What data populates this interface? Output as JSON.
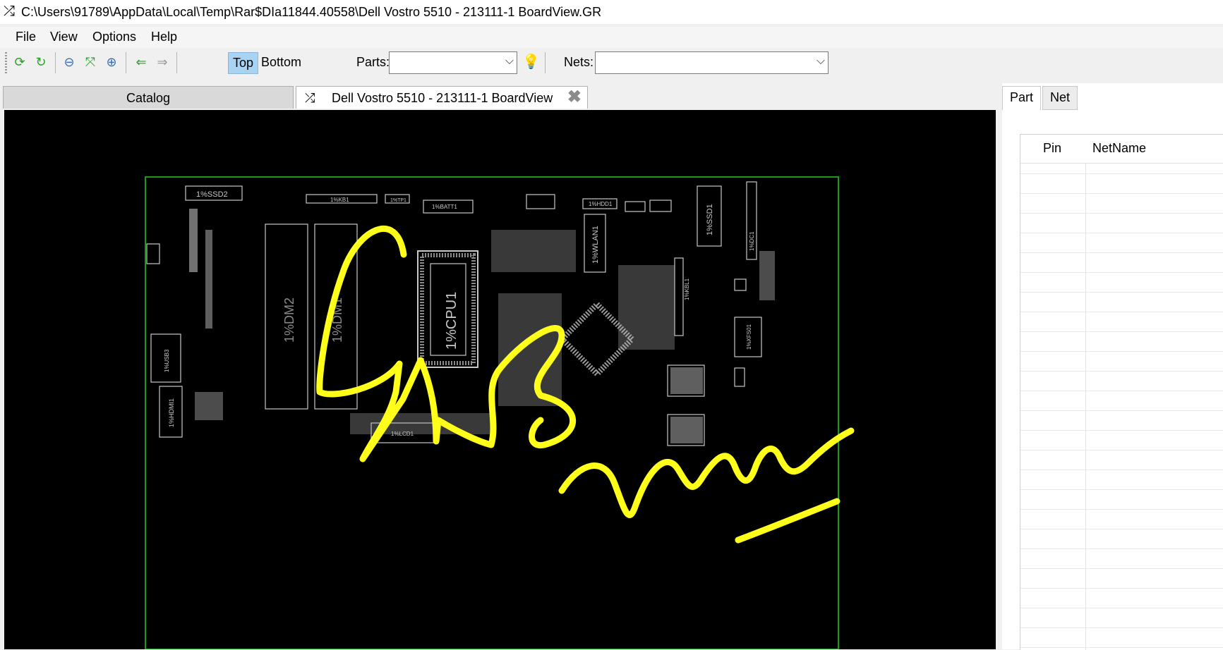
{
  "window": {
    "title": "C:\\Users\\91789\\AppData\\Local\\Temp\\Rar$DIa11844.40558\\Dell Vostro 5510 - 213111-1 BoardView.GR",
    "icon": "shuffle-icon"
  },
  "menu": [
    "File",
    "View",
    "Options",
    "Help"
  ],
  "toolbar": {
    "buttons": [
      "refresh-icon",
      "rotate-icon",
      "zoom-out-icon",
      "fit-icon",
      "zoom-in-icon",
      "back-arrow-icon",
      "forward-arrow-icon"
    ],
    "top_label": "Top",
    "bottom_label": "Bottom",
    "parts_label": "Parts:",
    "parts_value": "",
    "nets_label": "Nets:",
    "nets_value": ""
  },
  "tabs": {
    "catalog": "Catalog",
    "board": "Dell Vostro 5510 - 213111-1 BoardView"
  },
  "board": {
    "labels": [
      "1%SSD2",
      "1%KB1",
      "1%TP1",
      "1%BATT1",
      "1%HDD1",
      "1%SSD1",
      "1%WLAN1",
      "1%CPU1",
      "1%DM2",
      "1%DM1",
      "1%USB3",
      "1%HDMI1",
      "1%LCD1",
      "1%KBL1",
      "1%DC1",
      "1%XFS01"
    ],
    "annotation_color": "#ffff1a",
    "outline_color": "#1a9a1a"
  },
  "right_panel": {
    "tab_part": "Part",
    "tab_net": "Net",
    "col_pin": "Pin",
    "col_netname": "NetName"
  }
}
